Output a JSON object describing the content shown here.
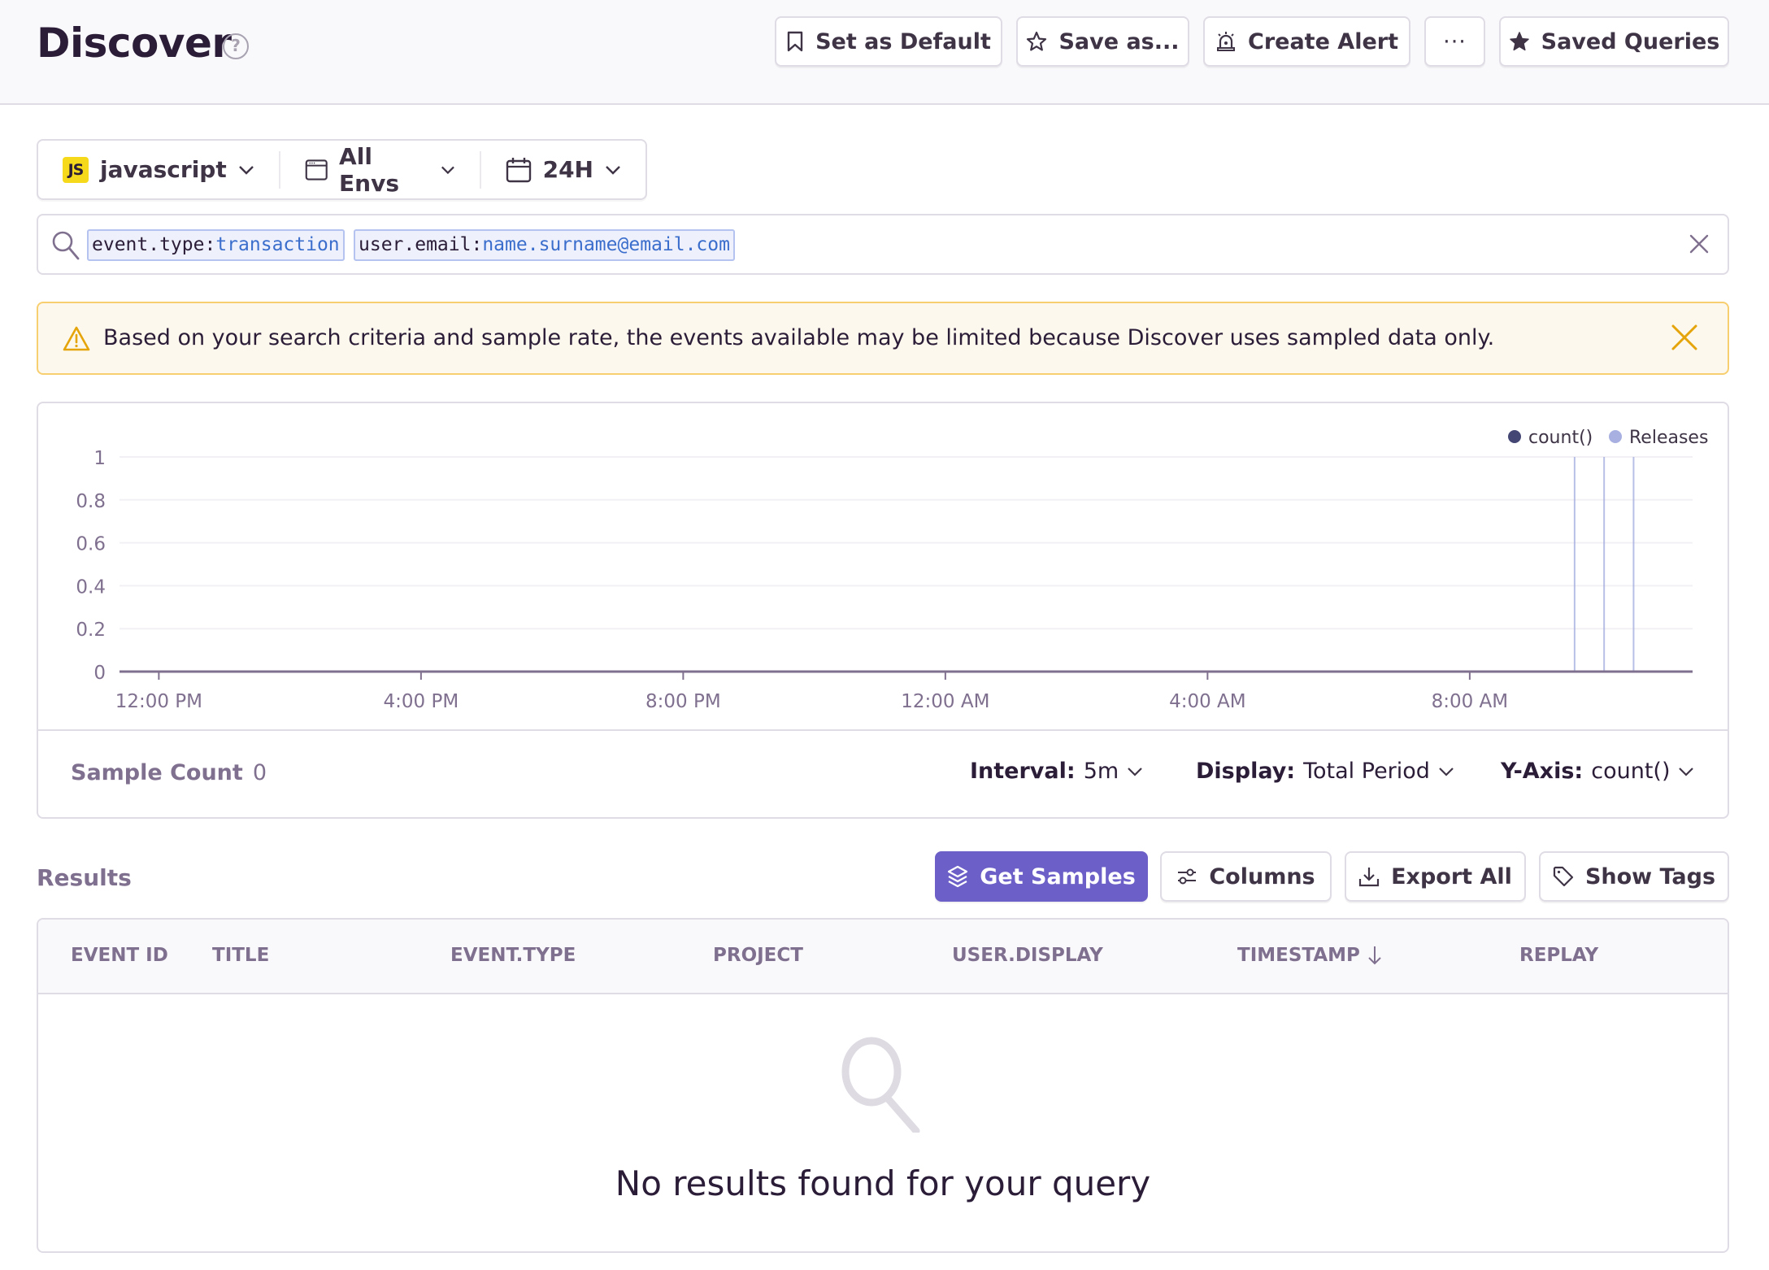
{
  "header": {
    "title": "Discover",
    "help_icon": "question-circle-icon",
    "buttons": {
      "set_default": "Set as Default",
      "save_as": "Save as...",
      "create_alert": "Create Alert",
      "more": "···",
      "saved_queries": "Saved Queries"
    }
  },
  "filters": {
    "project": {
      "badge": "JS",
      "label": "javascript"
    },
    "environment": {
      "label": "All Envs"
    },
    "date_range": {
      "label": "24H"
    }
  },
  "search": {
    "tokens": [
      {
        "key": "event.type:",
        "value": "transaction"
      },
      {
        "key": "user.email:",
        "value": "name.surname@email.com"
      }
    ]
  },
  "alert": {
    "text": "Based on your search criteria and sample rate, the events available may be limited because Discover uses sampled data only.",
    "level": "warning"
  },
  "chart_data": {
    "type": "line",
    "title": "",
    "xlabel": "",
    "ylabel": "",
    "ylim": [
      0,
      1
    ],
    "y_ticks": [
      "0",
      "0.2",
      "0.4",
      "0.6",
      "0.8",
      "1"
    ],
    "y_tick_values": [
      0,
      0.2,
      0.4,
      0.6,
      0.8,
      1
    ],
    "x_ticks": [
      "12:00 PM",
      "4:00 PM",
      "8:00 PM",
      "12:00 AM",
      "4:00 AM",
      "8:00 AM"
    ],
    "x_range_hours": [
      -0.6,
      23.4
    ],
    "x_tick_hours": [
      0,
      4,
      8,
      12,
      16,
      20
    ],
    "series": [
      {
        "name": "count()",
        "color": "#444674",
        "values": "all zero"
      }
    ],
    "releases": {
      "name": "Releases",
      "color": "#a7b0e0",
      "hours": [
        21.6,
        22.05,
        22.5
      ]
    },
    "legend": [
      "count()",
      "Releases"
    ],
    "legend_position": "top-right",
    "grid": true
  },
  "chart_footer": {
    "sample_count_label": "Sample Count",
    "sample_count_value": "0",
    "interval_label": "Interval:",
    "interval_value": "5m",
    "display_label": "Display:",
    "display_value": "Total Period",
    "yaxis_label": "Y-Axis:",
    "yaxis_value": "count()"
  },
  "results": {
    "label": "Results",
    "buttons": {
      "get_samples": "Get Samples",
      "columns": "Columns",
      "export_all": "Export All",
      "show_tags": "Show Tags"
    },
    "columns": [
      "EVENT ID",
      "TITLE",
      "EVENT.TYPE",
      "PROJECT",
      "USER.DISPLAY",
      "TIMESTAMP",
      "REPLAY"
    ],
    "sorted_column": "TIMESTAMP",
    "sort_direction": "descending",
    "rows": [],
    "empty_message": "No results found for your query"
  },
  "colors": {
    "accent": "#6c5fc7",
    "warning_border": "#f8cf70",
    "warning_bg": "#fcf8ed",
    "warning_icon": "#e5a50a"
  }
}
